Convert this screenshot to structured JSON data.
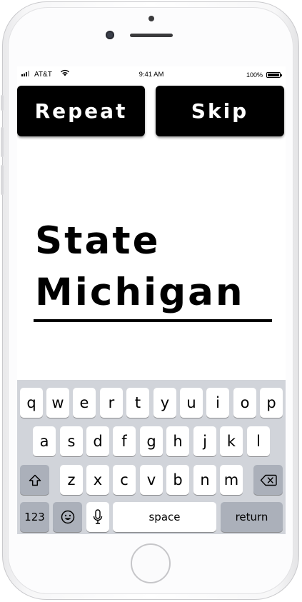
{
  "status_bar": {
    "carrier": "AT&T",
    "time": "9:41 AM",
    "battery_percent": "100%"
  },
  "buttons": {
    "repeat": "Repeat",
    "skip": "Skip"
  },
  "prompt": {
    "label": "State",
    "answer": "Michigan"
  },
  "keyboard": {
    "row1": [
      "q",
      "w",
      "e",
      "r",
      "t",
      "y",
      "u",
      "i",
      "o",
      "p"
    ],
    "row2": [
      "a",
      "s",
      "d",
      "f",
      "g",
      "h",
      "j",
      "k",
      "l"
    ],
    "row3": [
      "z",
      "x",
      "c",
      "v",
      "b",
      "n",
      "m"
    ],
    "numbers_key": "123",
    "space_key": "space",
    "return_key": "return"
  },
  "icons": {
    "wifi": "wifi-icon",
    "battery": "battery-icon",
    "shift": "shift-icon",
    "backspace": "backspace-icon",
    "emoji": "emoji-icon",
    "mic": "mic-icon",
    "signal": "signal-icon"
  },
  "colors": {
    "button_bg": "#000000",
    "button_text": "#ffffff",
    "keyboard_bg": "#d1d4da",
    "key_bg": "#ffffff",
    "key_dark_bg": "#abb0ba"
  }
}
